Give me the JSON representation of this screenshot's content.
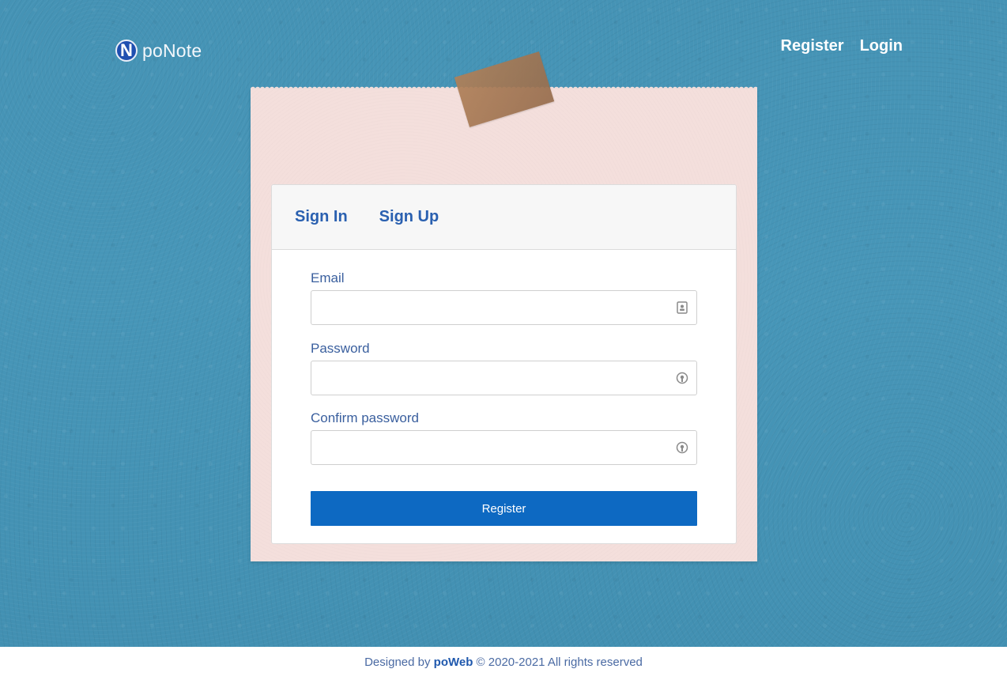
{
  "header": {
    "logo_letter": "N",
    "logo_text": "poNote",
    "nav": {
      "register": "Register",
      "login": "Login"
    }
  },
  "auth_card": {
    "tabs": {
      "sign_in": "Sign In",
      "sign_up": "Sign Up"
    },
    "fields": {
      "email": {
        "label": "Email",
        "value": "",
        "icon": "contact-card-icon"
      },
      "password": {
        "label": "Password",
        "value": "",
        "icon": "lock-icon"
      },
      "confirm_password": {
        "label": "Confirm password",
        "value": "",
        "icon": "lock-icon"
      }
    },
    "submit_label": "Register"
  },
  "footer": {
    "prefix": "Designed by",
    "brand": "poWeb",
    "suffix": "© 2020-2021 All rights reserved"
  },
  "colors": {
    "background": "#4593b5",
    "paper": "#f4dfdc",
    "accent": "#0d69c2",
    "tab_text": "#2a60b0"
  }
}
